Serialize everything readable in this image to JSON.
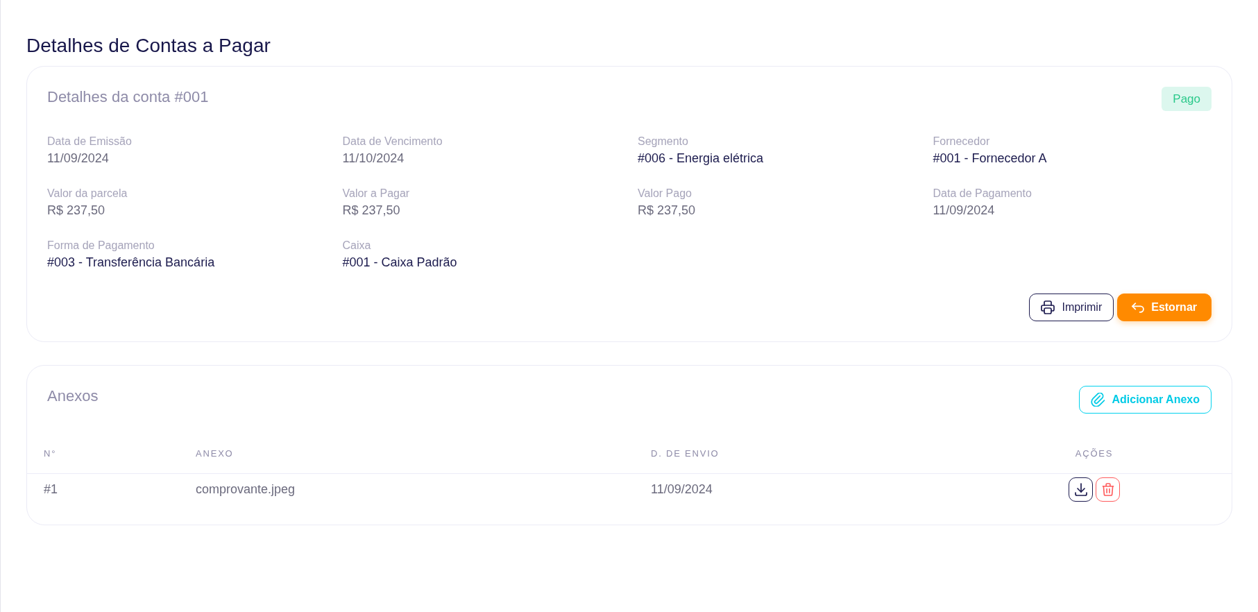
{
  "page": {
    "title": "Detalhes de Contas a Pagar"
  },
  "account_card": {
    "title": "Detalhes da conta #001",
    "status": {
      "label": "Pago",
      "kind": "paid"
    },
    "fields": [
      {
        "label": "Data de Emissão",
        "value": "11/09/2024",
        "kind": "plain"
      },
      {
        "label": "Data de Vencimento",
        "value": "11/10/2024",
        "kind": "plain"
      },
      {
        "label": "Segmento",
        "value": "#006 - Energia elétrica",
        "kind": "reference"
      },
      {
        "label": "Fornecedor",
        "value": "#001 - Fornecedor A",
        "kind": "reference"
      },
      {
        "label": "Valor da parcela",
        "value": "R$ 237,50",
        "kind": "plain"
      },
      {
        "label": "Valor a Pagar",
        "value": "R$ 237,50",
        "kind": "plain"
      },
      {
        "label": "Valor Pago",
        "value": "R$ 237,50",
        "kind": "plain"
      },
      {
        "label": "Data de Pagamento",
        "value": "11/09/2024",
        "kind": "plain"
      },
      {
        "label": "Forma de Pagamento",
        "value": "#003 - Transferência Bancária",
        "kind": "reference"
      },
      {
        "label": "Caixa",
        "value": "#001 - Caixa Padrão",
        "kind": "reference"
      }
    ],
    "buttons": [
      {
        "label": "Imprimir",
        "kind": "print"
      },
      {
        "label": "Estornar",
        "kind": "reverse"
      }
    ]
  },
  "attachments_card": {
    "title": "Anexos",
    "add_button": {
      "label": "Adicionar Anexo"
    },
    "table": {
      "columns": [
        "N°",
        "ANEXO",
        "D. DE ENVIO",
        "AÇÕES"
      ],
      "rows": [
        {
          "number": "#1",
          "file": "comprovante.jpeg",
          "sent_date": "11/09/2024",
          "actions": [
            {
              "kind": "download"
            },
            {
              "kind": "delete"
            }
          ]
        }
      ]
    }
  }
}
